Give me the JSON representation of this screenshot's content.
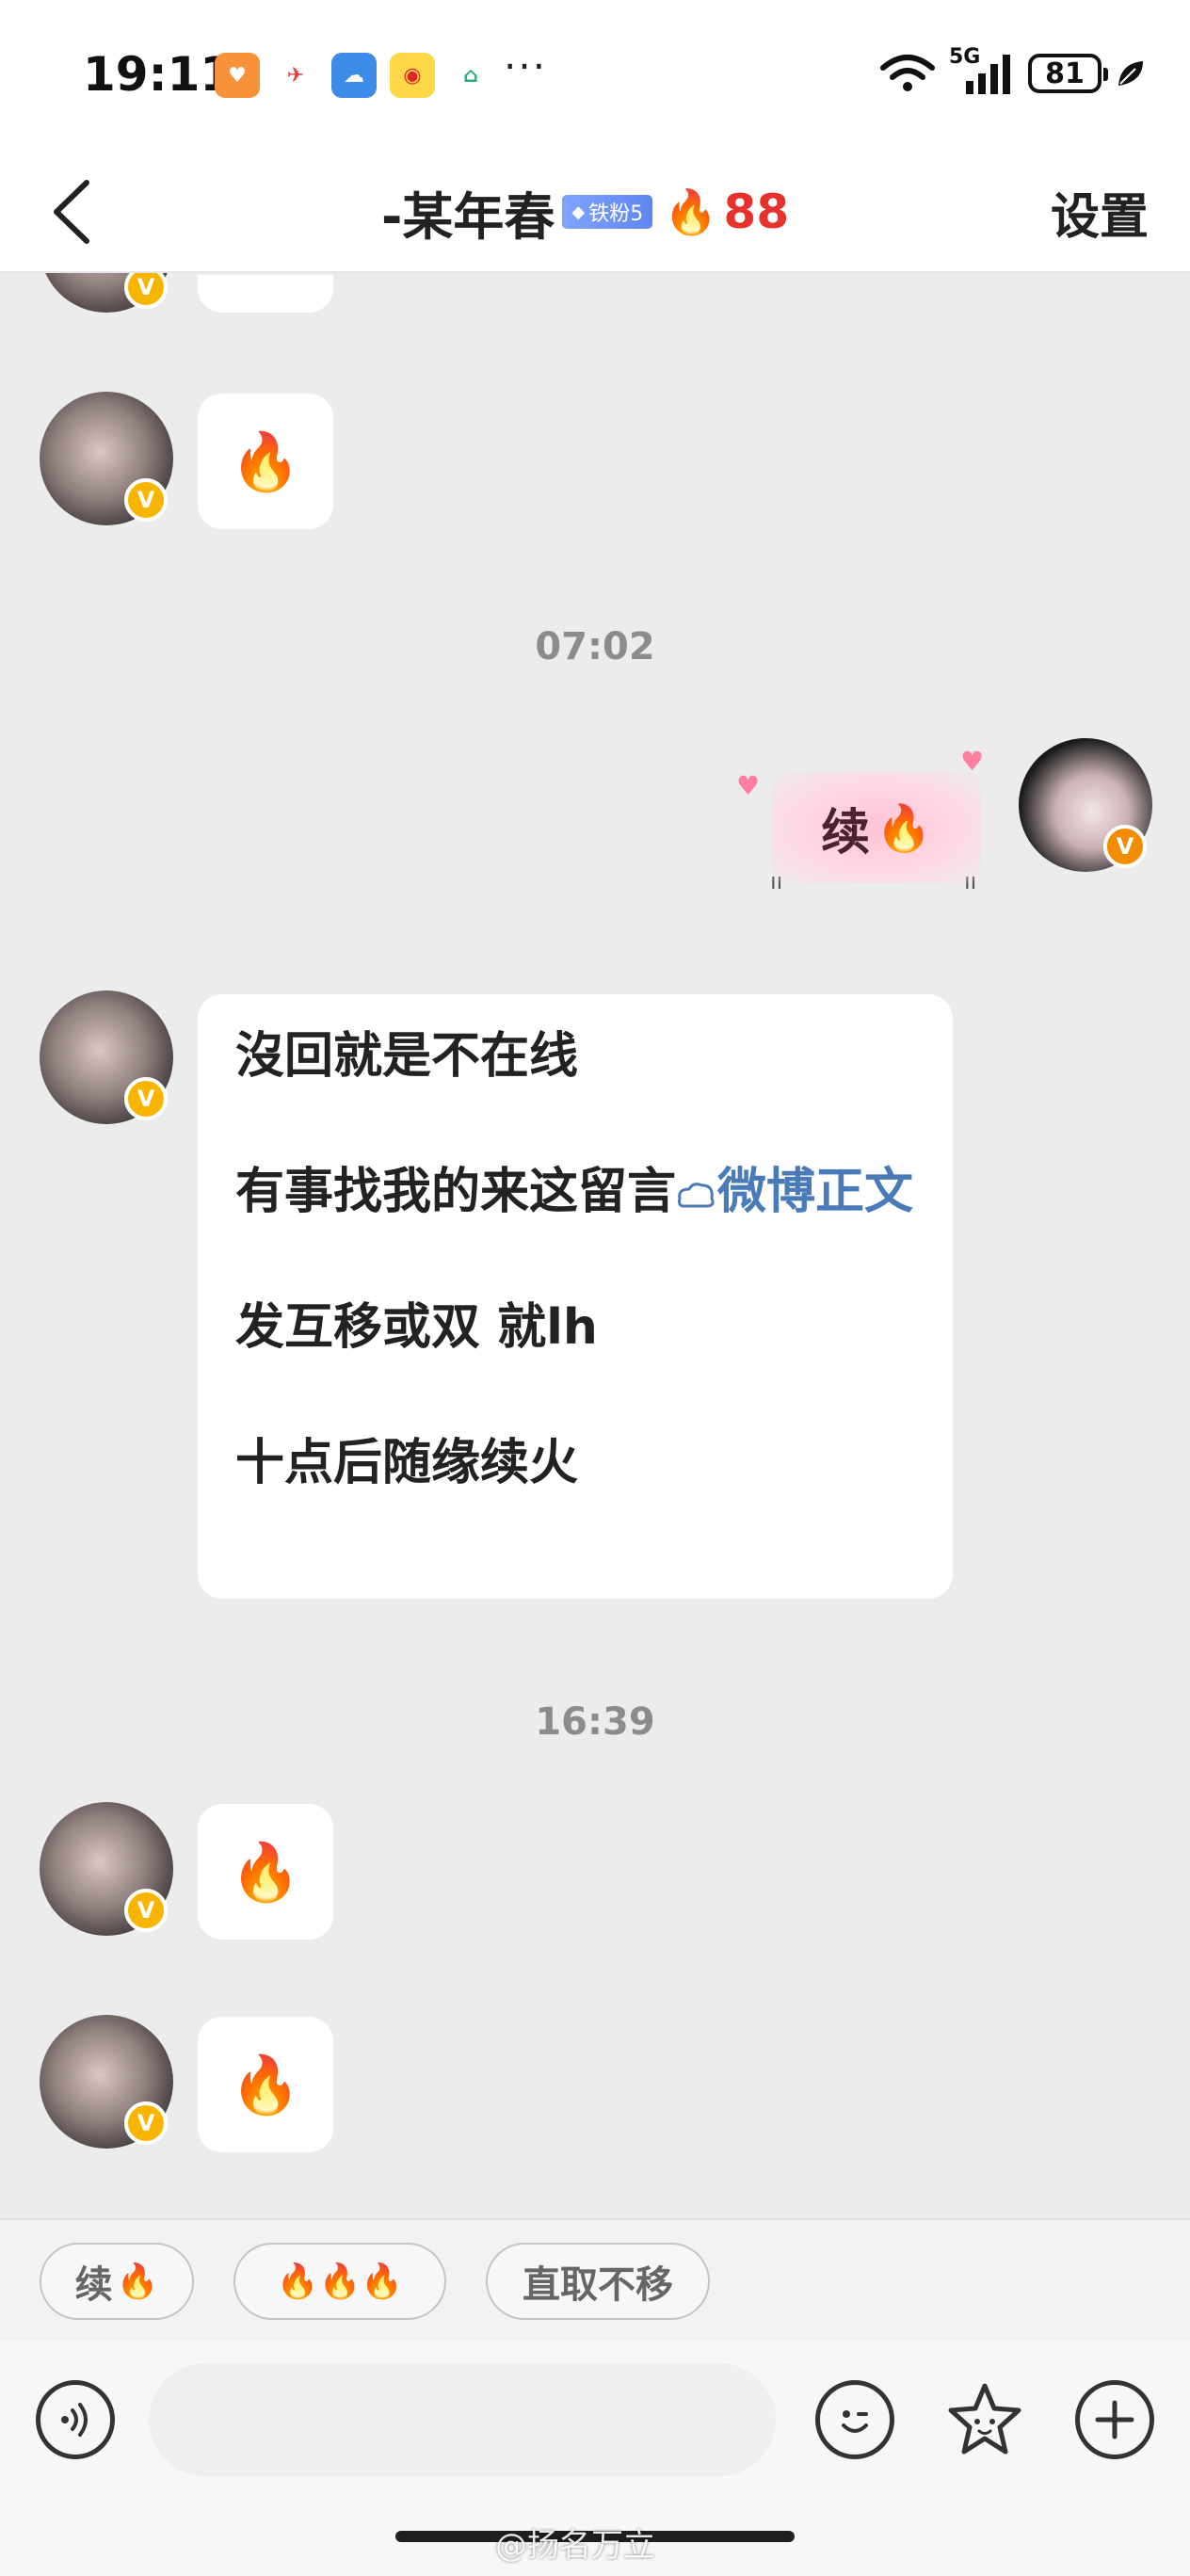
{
  "status_bar": {
    "time": "19:11",
    "network": "5G",
    "battery": "81",
    "more": "···"
  },
  "header": {
    "title": "-某年春",
    "fan_badge": "铁粉5",
    "fire_count": "88",
    "settings": "设置"
  },
  "messages": {
    "fire": "🔥",
    "timestamp_1": "07:02",
    "my_message_text": "续",
    "notice_line1": "沒回就是不在线",
    "notice_line2_text": "有事找我的来这留言",
    "notice_line2_link": "微博正文",
    "notice_line3": "发互移或双 就lh",
    "notice_line4": "十点后随缘续火",
    "timestamp_2": "16:39"
  },
  "quick_replies": {
    "chip1_text": "续",
    "chip2_text": "🔥🔥🔥",
    "chip3_text": "直取不移"
  },
  "watermark": "@扬名万立",
  "colors": {
    "fire_number": "#e5322d",
    "link": "#4a7bb8",
    "verified_badge": "#f7b500",
    "chat_background": "#ececec"
  }
}
